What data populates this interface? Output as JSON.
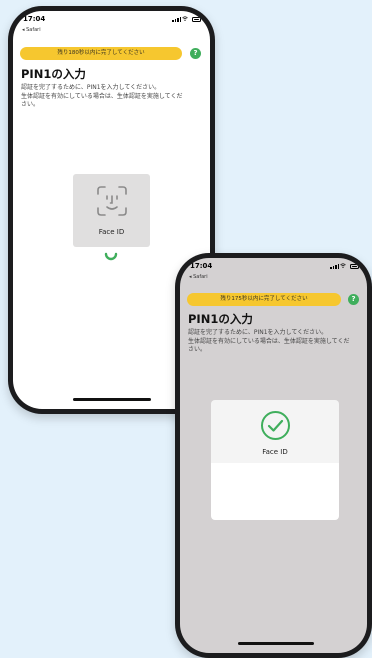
{
  "phone1": {
    "time": "17:04",
    "back_label": "◂ Safari",
    "banner": "残り180秒以内に完了してください",
    "help_icon": "?",
    "title": "PIN1の入力",
    "desc_line1": "認証を完了するために、PIN1を入力してください。",
    "desc_line2": "生体認証を有効にしている場合は、生体認証を実施してくだ",
    "desc_line3": "さい。",
    "faceid_label": "Face ID"
  },
  "phone2": {
    "time": "17:04",
    "back_label": "◂ Safari",
    "banner": "残り175秒以内に完了してください",
    "help_icon": "?",
    "title": "PIN1の入力",
    "desc_line1": "認証を完了するために、PIN1を入力してください。",
    "desc_line2": "生体認証を有効にしている場合は、生体認証を実施してくだ",
    "desc_line3": "さい。",
    "faceid_label": "Face ID"
  },
  "colors": {
    "background": "#e3f1fb",
    "banner": "#f6c72f",
    "help_button": "#3fae5c",
    "checkmark": "#3fae5c",
    "spinner": "#3fae5c"
  },
  "icons": {
    "faceid_scan": "face-id-icon",
    "faceid_success": "checkmark-circle-icon",
    "loading": "spinner-icon"
  }
}
